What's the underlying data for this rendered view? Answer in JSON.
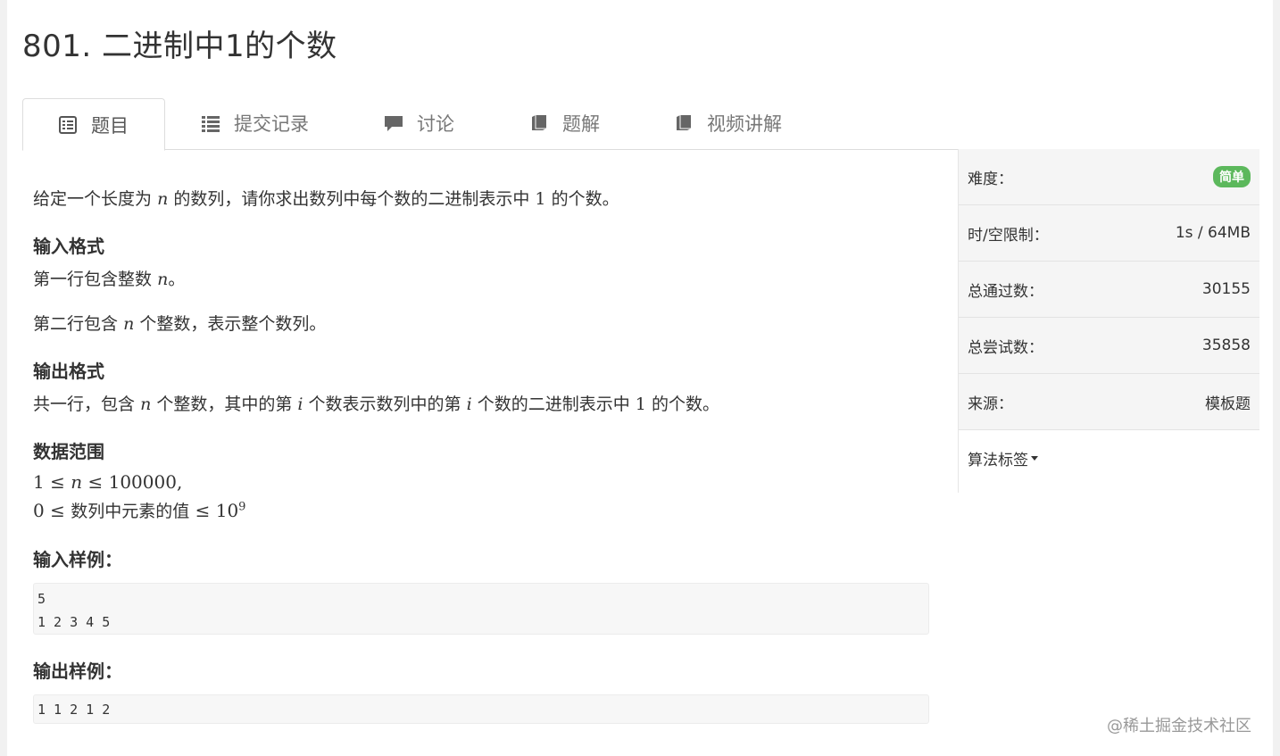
{
  "problem": {
    "title": "801. 二进制中1的个数"
  },
  "tabs": [
    {
      "label": "题目",
      "icon": "list-alt-icon"
    },
    {
      "label": "提交记录",
      "icon": "list-icon"
    },
    {
      "label": "讨论",
      "icon": "comment-icon"
    },
    {
      "label": "题解",
      "icon": "book-icon"
    },
    {
      "label": "视频讲解",
      "icon": "book-icon"
    }
  ],
  "content": {
    "intro": {
      "before": "给定一个长度为",
      "var": "n",
      "middle": "的数列，请你求出数列中每个数的二进制表示中",
      "num": "1",
      "after": "的个数。"
    },
    "input_heading": "输入格式",
    "input_line1": {
      "before": "第一行包含整数",
      "var": "n",
      "after": "。"
    },
    "input_line2": {
      "before": "第二行包含",
      "var": "n",
      "after": "个整数，表示整个数列。"
    },
    "output_heading": "输出格式",
    "output_line": {
      "p1": "共一行，包含",
      "v1": "n",
      "p2": "个整数，其中的第",
      "v2": "i",
      "p3": "个数表示数列中的第",
      "v3": "i",
      "p4": "个数的二进制表示中",
      "num": "1",
      "p5": "的个数。"
    },
    "range_heading": "数据范围",
    "range1": {
      "a": "1",
      "op1": "≤",
      "var": "n",
      "op2": "≤",
      "b": "100000",
      "end": ","
    },
    "range2": {
      "a": "0",
      "op1": "≤",
      "text": "数列中元素的值",
      "op2": "≤",
      "base": "10",
      "exp": "9"
    },
    "sample_in_heading": "输入样例：",
    "sample_in": [
      "5",
      "1 2 3 4 5"
    ],
    "sample_out_heading": "输出样例：",
    "sample_out": [
      "1 1 2 1 2"
    ]
  },
  "sidebar": {
    "difficulty_label": "难度：",
    "difficulty_value": "简单",
    "limit_label": "时/空限制：",
    "limit_value": "1s / 64MB",
    "accepted_label": "总通过数：",
    "accepted_value": "30155",
    "attempts_label": "总尝试数：",
    "attempts_value": "35858",
    "source_label": "来源：",
    "source_value": "模板题",
    "tags_label": "算法标签"
  },
  "watermark": "@稀土掘金技术社区",
  "colors": {
    "badge_green": "#5cb85c",
    "tab_border": "#dddddd",
    "code_bg": "#f7f7f7"
  }
}
